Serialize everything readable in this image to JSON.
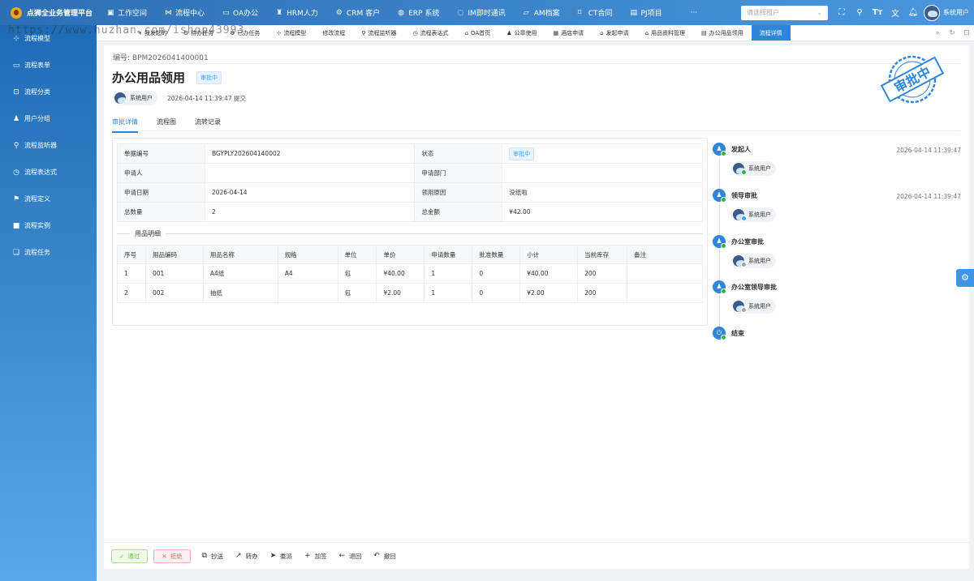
{
  "app": {
    "title": "点狮全业务管理平台",
    "user_select_placeholder": "请选择租户",
    "user_name": "系统用户"
  },
  "top_menu": [
    {
      "label": "工作空间",
      "icon": "workspace-icon"
    },
    {
      "label": "流程中心",
      "icon": "flow-icon"
    },
    {
      "label": "OA办公",
      "icon": "monitor-icon"
    },
    {
      "label": "HRM人力",
      "icon": "person-icon"
    },
    {
      "label": "CRM 客户",
      "icon": "gear-icon"
    },
    {
      "label": "ERP 系统",
      "icon": "globe-icon"
    },
    {
      "label": "IM即时通讯",
      "icon": "chat-icon"
    },
    {
      "label": "AM档案",
      "icon": "folder-icon"
    },
    {
      "label": "CT合同",
      "icon": "bookmark-icon"
    },
    {
      "label": "PJ项目",
      "icon": "project-icon"
    },
    {
      "label": "···",
      "icon": "more-icon"
    }
  ],
  "sidebar": [
    {
      "label": "流程模型",
      "icon": "⊹"
    },
    {
      "label": "流程表单",
      "icon": "▭"
    },
    {
      "label": "流程分类",
      "icon": "⊡"
    },
    {
      "label": "用户分组",
      "icon": "♟"
    },
    {
      "label": "流程监听器",
      "icon": "⚲"
    },
    {
      "label": "流程表达式",
      "icon": "◷"
    },
    {
      "label": "流程定义",
      "icon": "⚑"
    },
    {
      "label": "流程实例",
      "icon": "■"
    },
    {
      "label": "流程任务",
      "icon": "❏"
    }
  ],
  "tabs": [
    {
      "label": "我发起的",
      "icon": "✎",
      "active": false
    },
    {
      "label": "待办任务",
      "icon": "⚙",
      "active": false
    },
    {
      "label": "已办任务",
      "icon": "⚙",
      "active": false
    },
    {
      "label": "流程模型",
      "icon": "⊹",
      "active": false
    },
    {
      "label": "修改流程",
      "icon": "",
      "active": false
    },
    {
      "label": "流程监听器",
      "icon": "⚲",
      "active": false
    },
    {
      "label": "流程表达式",
      "icon": "◷",
      "active": false
    },
    {
      "label": "OA首页",
      "icon": "⌂",
      "active": false
    },
    {
      "label": "公章使用",
      "icon": "♟",
      "active": false
    },
    {
      "label": "酒店申请",
      "icon": "▦",
      "active": false
    },
    {
      "label": "发起申请",
      "icon": "⌂",
      "active": false
    },
    {
      "label": "用品资料管理",
      "icon": "⌂",
      "active": false
    },
    {
      "label": "办公用品领用",
      "icon": "▤",
      "active": false
    },
    {
      "label": "流程详情",
      "icon": "",
      "active": true
    }
  ],
  "watermark": "https://www.huzhan.com/ishop43993",
  "detail": {
    "doc_no": "编号: BPM2026041400001",
    "title": "办公用品领用",
    "status": "审批中",
    "submitter": "系统用户",
    "submit_time": "2026-04-14 11:39:47 提交",
    "stamp_text": "审批中",
    "tabs": [
      "审批详情",
      "流程图",
      "流转记录"
    ]
  },
  "form": {
    "rows": [
      {
        "l1": "单据编号",
        "v1": "BGYPLY202604140002",
        "l2": "状态",
        "v2": "审批中"
      },
      {
        "l1": "申请人",
        "v1": "",
        "l2": "申请部门",
        "v2": ""
      },
      {
        "l1": "申请日期",
        "v1": "2026-04-14",
        "l2": "领用原因",
        "v2": "没纸啦"
      },
      {
        "l1": "总数量",
        "v1": "2",
        "l2": "总金额",
        "v2": "¥42.00"
      }
    ],
    "section_title": "用品明细",
    "columns": [
      "序号",
      "用品编码",
      "用品名称",
      "规格",
      "单位",
      "单价",
      "申请数量",
      "批准数量",
      "小计",
      "当前库存",
      "备注"
    ],
    "items": [
      [
        "1",
        "001",
        "A4纸",
        "A4",
        "包",
        "¥40.00",
        "1",
        "0",
        "¥40.00",
        "200",
        ""
      ],
      [
        "2",
        "002",
        "抽纸",
        "",
        "包",
        "¥2.00",
        "1",
        "0",
        "¥2.00",
        "200",
        ""
      ]
    ]
  },
  "timeline": [
    {
      "name": "发起人",
      "time": "2026-04-14 11:39:47",
      "user": "系统用户",
      "mini": "#2fb344"
    },
    {
      "name": "领导审批",
      "time": "2026-04-14 11:39:47",
      "user": "系统用户",
      "mini": "#409eff"
    },
    {
      "name": "办公室审批",
      "time": "",
      "user": "系统用户",
      "mini": "#a0a0a0"
    },
    {
      "name": "办公室领导审批",
      "time": "",
      "user": "系统用户",
      "mini": "#a0a0a0"
    },
    {
      "name": "结束",
      "time": "",
      "user": "",
      "mini": ""
    }
  ],
  "footer": {
    "pass": "通过",
    "reject": "拒绝",
    "actions": [
      {
        "label": "抄送",
        "icon": "⧉"
      },
      {
        "label": "转办",
        "icon": "↗"
      },
      {
        "label": "委派",
        "icon": "➤"
      },
      {
        "label": "加签",
        "icon": "+"
      },
      {
        "label": "退回",
        "icon": "←"
      },
      {
        "label": "撤回",
        "icon": "↶"
      }
    ]
  }
}
